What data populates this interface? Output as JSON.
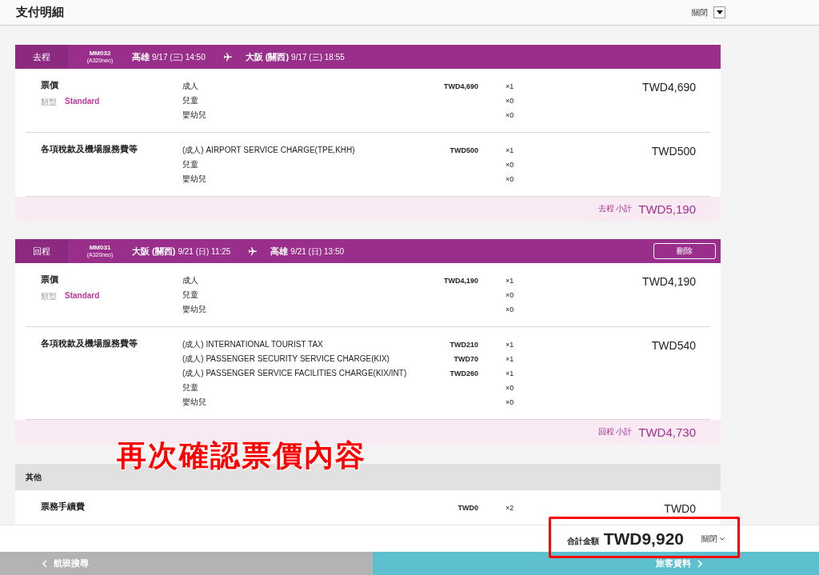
{
  "header": {
    "title": "支付明細",
    "collapse_label": "關閉"
  },
  "flights": [
    {
      "direction": "去程",
      "flight_no": "MM032",
      "aircraft": "(A320neo)",
      "origin": "高雄",
      "depart": "9/17 (三) 14:50",
      "destination": "大阪 (關西)",
      "arrive": "9/17 (三) 18:55",
      "groups": [
        {
          "label": "票價",
          "type_label": "類型",
          "fare_type": "Standard",
          "lines": [
            {
              "name": "成人",
              "price": "TWD4,690",
              "qty": "×1"
            },
            {
              "name": "兒童",
              "qty": "×0"
            },
            {
              "name": "嬰幼兒",
              "qty": "×0"
            }
          ],
          "total": "TWD4,690"
        },
        {
          "label": "各項稅款及機場服務費等",
          "lines": [
            {
              "name": "(成人) AIRPORT SERVICE CHARGE(TPE,KHH)",
              "price": "TWD500",
              "qty": "×1"
            },
            {
              "name": "兒童",
              "qty": "×0"
            },
            {
              "name": "嬰幼兒",
              "qty": "×0"
            }
          ],
          "total": "TWD500"
        }
      ],
      "subtotal_label": "去程 小計",
      "subtotal": "TWD5,190"
    },
    {
      "direction": "回程",
      "flight_no": "MM031",
      "aircraft": "(A320neo)",
      "origin": "大阪 (關西)",
      "depart": "9/21 (日) 11:25",
      "destination": "高雄",
      "arrive": "9/21 (日) 13:50",
      "delete_button": "刪除",
      "groups": [
        {
          "label": "票價",
          "type_label": "類型",
          "fare_type": "Standard",
          "lines": [
            {
              "name": "成人",
              "price": "TWD4,190",
              "qty": "×1"
            },
            {
              "name": "兒童",
              "qty": "×0"
            },
            {
              "name": "嬰幼兒",
              "qty": "×0"
            }
          ],
          "total": "TWD4,190"
        },
        {
          "label": "各項稅款及機場服務費等",
          "lines": [
            {
              "name": "(成人) INTERNATIONAL TOURIST TAX",
              "price": "TWD210",
              "qty": "×1"
            },
            {
              "name": "(成人) PASSENGER SECURITY SERVICE CHARGE(KIX)",
              "price": "TWD70",
              "qty": "×1"
            },
            {
              "name": "(成人) PASSENGER SERVICE FACILITIES CHARGE(KIX/INT)",
              "price": "TWD260",
              "qty": "×1"
            },
            {
              "name": "兒童",
              "qty": "×0"
            },
            {
              "name": "嬰幼兒",
              "qty": "×0"
            }
          ],
          "total": "TWD540"
        }
      ],
      "subtotal_label": "回程 小計",
      "subtotal": "TWD4,730"
    }
  ],
  "other": {
    "title": "其他",
    "groups": [
      {
        "label": "票務手續費",
        "lines": [
          {
            "price": "TWD0",
            "qty": "×2"
          }
        ],
        "total": "TWD0"
      }
    ]
  },
  "annotation": {
    "text": "再次確認票價內容"
  },
  "total_bar": {
    "label": "合計金額",
    "amount": "TWD9,920",
    "toggle": "關閉"
  },
  "nav": {
    "back": "航班搜尋",
    "next": "旅客資料"
  }
}
